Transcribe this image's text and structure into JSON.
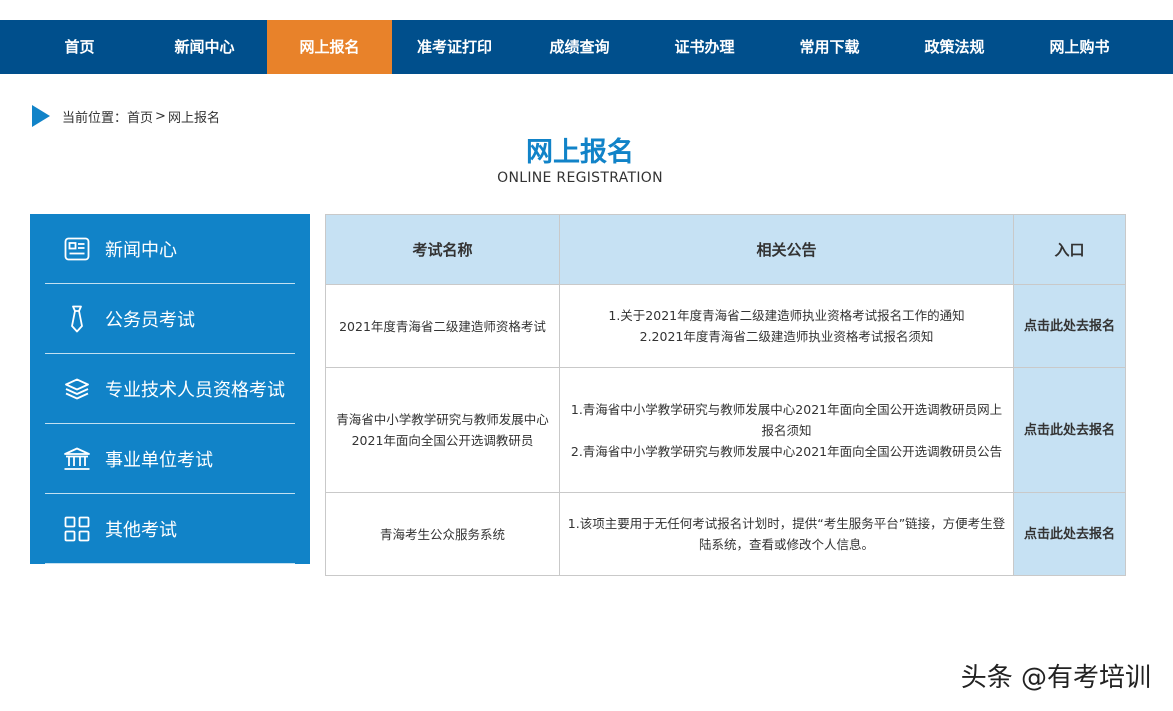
{
  "nav": {
    "items": [
      "首页",
      "新闻中心",
      "网上报名",
      "准考证打印",
      "成绩查询",
      "证书办理",
      "常用下载",
      "政策法规",
      "网上购书"
    ],
    "active_index": 2
  },
  "breadcrumb": {
    "prefix": "当前位置：",
    "home": "首页",
    "separator": ">",
    "current": "网上报名"
  },
  "page": {
    "title": "网上报名",
    "subtitle": "ONLINE REGISTRATION"
  },
  "sidebar": {
    "items": [
      {
        "label": "新闻中心",
        "icon": "news-icon"
      },
      {
        "label": "公务员考试",
        "icon": "tie-icon"
      },
      {
        "label": "专业技术人员资格考试",
        "icon": "layers-icon"
      },
      {
        "label": "事业单位考试",
        "icon": "building-icon"
      },
      {
        "label": "其他考试",
        "icon": "grid-icon"
      }
    ]
  },
  "table": {
    "headers": [
      "考试名称",
      "相关公告",
      "入口"
    ],
    "rows": [
      {
        "name": "2021年度青海省二级建造师资格考试",
        "notices": [
          "1.关于2021年度青海省二级建造师执业资格考试报名工作的通知",
          "2.2021年度青海省二级建造师执业资格考试报名须知"
        ],
        "entry": "点击此处去报名"
      },
      {
        "name": "青海省中小学教学研究与教师发展中心2021年面向全国公开选调教研员",
        "notices": [
          "1.青海省中小学教学研究与教师发展中心2021年面向全国公开选调教研员网上报名须知",
          "2.青海省中小学教学研究与教师发展中心2021年面向全国公开选调教研员公告"
        ],
        "entry": "点击此处去报名"
      },
      {
        "name": "青海考生公众服务系统",
        "notices": [
          "1.该项主要用于无任何考试报名计划时，提供“考生服务平台”链接，方便考生登陆系统，查看或修改个人信息。"
        ],
        "entry": "点击此处去报名"
      }
    ]
  },
  "watermark": "头条 @有考培训",
  "colors": {
    "nav_bg": "#004f8c",
    "nav_active": "#e8822a",
    "accent": "#1183c8",
    "table_header_bg": "#c6e1f3"
  }
}
